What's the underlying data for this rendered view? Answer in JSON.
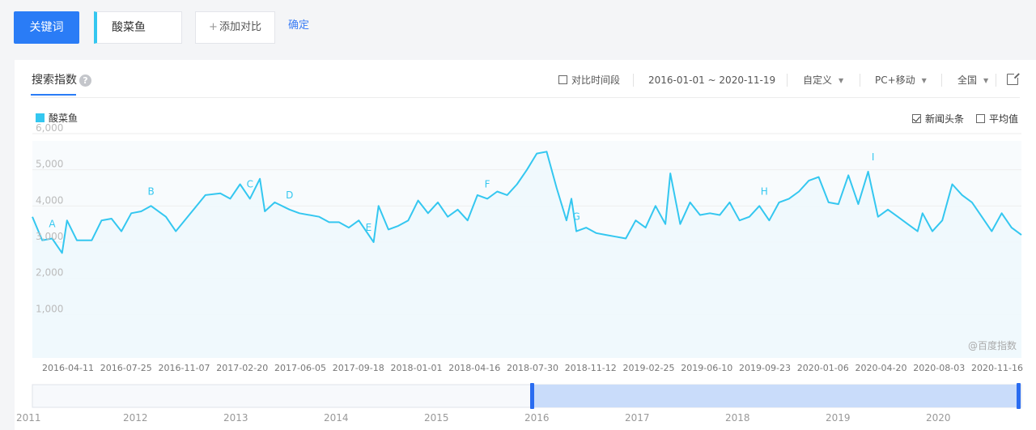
{
  "toolbar": {
    "keyword_button": "关键词",
    "keyword_value": "酸菜鱼",
    "add_compare_label": "添加对比",
    "confirm_label": "确定"
  },
  "panel": {
    "tab_title": "搜索指数",
    "compare_period_label": "对比时间段",
    "date_range": "2016-01-01 ~ 2020-11-19",
    "range_select": "自定义",
    "device_select": "PC+移动",
    "region_select": "全国",
    "legend_label": "酸菜鱼",
    "news_headline_label": "新闻头条",
    "news_headline_checked": true,
    "average_label": "平均值",
    "average_checked": false,
    "compare_period_checked": false,
    "watermark": "@百度指数"
  },
  "colors": {
    "accent": "#2a7cf6",
    "series": "#34c7f0",
    "area_fill": "#eef8fd"
  },
  "icons": [
    "help-icon",
    "external-link-icon",
    "plus-icon",
    "caret-down-icon"
  ],
  "chart_data": {
    "type": "area",
    "series": [
      {
        "name": "酸菜鱼"
      }
    ],
    "ylim": [
      0,
      6000
    ],
    "yticks": [
      "1,000",
      "2,000",
      "3,000",
      "4,000",
      "5,000",
      "6,000"
    ],
    "x_tick_labels": [
      "2016-04-11",
      "2016-07-25",
      "2016-11-07",
      "2017-02-20",
      "2017-06-05",
      "2017-09-18",
      "2018-01-01",
      "2018-04-16",
      "2018-07-30",
      "2018-11-12",
      "2019-02-25",
      "2019-06-10",
      "2019-09-23",
      "2020-01-06",
      "2020-04-20",
      "2020-08-03",
      "2020-11-16"
    ],
    "annotations": [
      "A",
      "B",
      "C",
      "D",
      "E",
      "F",
      "G",
      "H",
      "I"
    ],
    "points": [
      [
        0,
        3700
      ],
      [
        0.01,
        3050
      ],
      [
        0.02,
        3100
      ],
      [
        0.03,
        2700
      ],
      [
        0.035,
        3600
      ],
      [
        0.045,
        3050
      ],
      [
        0.06,
        3050
      ],
      [
        0.07,
        3600
      ],
      [
        0.08,
        3650
      ],
      [
        0.09,
        3300
      ],
      [
        0.1,
        3800
      ],
      [
        0.11,
        3850
      ],
      [
        0.12,
        4000
      ],
      [
        0.135,
        3700
      ],
      [
        0.145,
        3300
      ],
      [
        0.16,
        3800
      ],
      [
        0.175,
        4300
      ],
      [
        0.19,
        4350
      ],
      [
        0.2,
        4200
      ],
      [
        0.21,
        4600
      ],
      [
        0.22,
        4200
      ],
      [
        0.23,
        4750
      ],
      [
        0.235,
        3850
      ],
      [
        0.245,
        4100
      ],
      [
        0.26,
        3900
      ],
      [
        0.27,
        3800
      ],
      [
        0.29,
        3700
      ],
      [
        0.3,
        3550
      ],
      [
        0.31,
        3550
      ],
      [
        0.32,
        3400
      ],
      [
        0.33,
        3600
      ],
      [
        0.345,
        3000
      ],
      [
        0.35,
        4000
      ],
      [
        0.36,
        3350
      ],
      [
        0.37,
        3450
      ],
      [
        0.38,
        3600
      ],
      [
        0.39,
        4150
      ],
      [
        0.4,
        3800
      ],
      [
        0.41,
        4100
      ],
      [
        0.42,
        3700
      ],
      [
        0.43,
        3900
      ],
      [
        0.44,
        3600
      ],
      [
        0.45,
        4300
      ],
      [
        0.46,
        4200
      ],
      [
        0.47,
        4400
      ],
      [
        0.48,
        4300
      ],
      [
        0.49,
        4600
      ],
      [
        0.5,
        5000
      ],
      [
        0.51,
        5450
      ],
      [
        0.52,
        5500
      ],
      [
        0.53,
        4500
      ],
      [
        0.54,
        3600
      ],
      [
        0.545,
        4200
      ],
      [
        0.55,
        3300
      ],
      [
        0.56,
        3400
      ],
      [
        0.57,
        3250
      ],
      [
        0.58,
        3200
      ],
      [
        0.59,
        3150
      ],
      [
        0.6,
        3100
      ],
      [
        0.61,
        3600
      ],
      [
        0.62,
        3400
      ],
      [
        0.63,
        4000
      ],
      [
        0.64,
        3500
      ],
      [
        0.645,
        4900
      ],
      [
        0.655,
        3500
      ],
      [
        0.665,
        4100
      ],
      [
        0.675,
        3750
      ],
      [
        0.685,
        3800
      ],
      [
        0.695,
        3750
      ],
      [
        0.705,
        4100
      ],
      [
        0.715,
        3600
      ],
      [
        0.725,
        3700
      ],
      [
        0.735,
        4000
      ],
      [
        0.745,
        3600
      ],
      [
        0.755,
        4100
      ],
      [
        0.765,
        4200
      ],
      [
        0.775,
        4400
      ],
      [
        0.785,
        4700
      ],
      [
        0.795,
        4800
      ],
      [
        0.805,
        4100
      ],
      [
        0.815,
        4050
      ],
      [
        0.825,
        4850
      ],
      [
        0.835,
        4050
      ],
      [
        0.845,
        4950
      ],
      [
        0.855,
        3700
      ],
      [
        0.865,
        3900
      ],
      [
        0.875,
        3700
      ],
      [
        0.885,
        3500
      ],
      [
        0.895,
        3300
      ],
      [
        0.9,
        3800
      ],
      [
        0.91,
        3300
      ],
      [
        0.92,
        3600
      ],
      [
        0.93,
        4600
      ],
      [
        0.94,
        4300
      ],
      [
        0.95,
        4100
      ],
      [
        0.96,
        3700
      ],
      [
        0.97,
        3300
      ],
      [
        0.98,
        3800
      ],
      [
        0.99,
        3400
      ],
      [
        1.0,
        3200
      ]
    ]
  },
  "navigator": {
    "years": [
      "2011",
      "2012",
      "2013",
      "2014",
      "2015",
      "2016",
      "2017",
      "2018",
      "2019",
      "2020"
    ]
  }
}
